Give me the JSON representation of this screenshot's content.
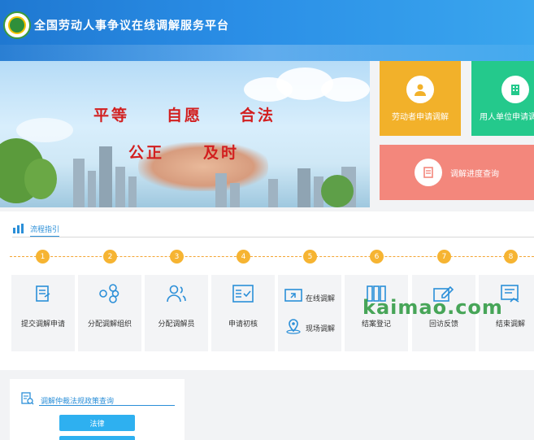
{
  "header": {
    "title": "全国劳动人事争议在线调解服务平台"
  },
  "banner": {
    "slogan_line1": [
      "平等",
      "自愿",
      "合法"
    ],
    "slogan_line2": [
      "公正",
      "及时"
    ]
  },
  "tiles": [
    {
      "label": "劳动者申请调解",
      "icon": "user-icon",
      "color": "#f2b12a"
    },
    {
      "label": "用人单位申请调",
      "icon": "building-icon",
      "color": "#24c98c"
    },
    {
      "label": "调解进度查询",
      "icon": "document-icon",
      "color": "#f3877c"
    }
  ],
  "process": {
    "title": "流程指引",
    "steps": [
      {
        "num": "1",
        "label": "提交调解申请",
        "icon": "submit-icon"
      },
      {
        "num": "2",
        "label": "分配调解组织",
        "icon": "organization-icon"
      },
      {
        "num": "3",
        "label": "分配调解员",
        "icon": "people-icon"
      },
      {
        "num": "4",
        "label": "申请初核",
        "icon": "checklist-icon"
      },
      {
        "num": "5",
        "label_online": "在线调解",
        "label_onsite": "现场调解",
        "icon_online": "online-icon",
        "icon_onsite": "location-icon"
      },
      {
        "num": "6",
        "label": "结案登记",
        "icon": "books-icon"
      },
      {
        "num": "7",
        "label": "回访反馈",
        "icon": "feedback-icon"
      },
      {
        "num": "8",
        "label": "结束调解",
        "icon": "end-icon"
      }
    ]
  },
  "laws": {
    "title": "调解仲裁法规政策查询",
    "buttons": [
      "法律",
      ""
    ]
  },
  "watermark": "kaimao.com",
  "colors": {
    "header": "#2a8ee6",
    "accent": "#2b8fd8",
    "step": "#f6b432",
    "button": "#2eb0f0"
  }
}
